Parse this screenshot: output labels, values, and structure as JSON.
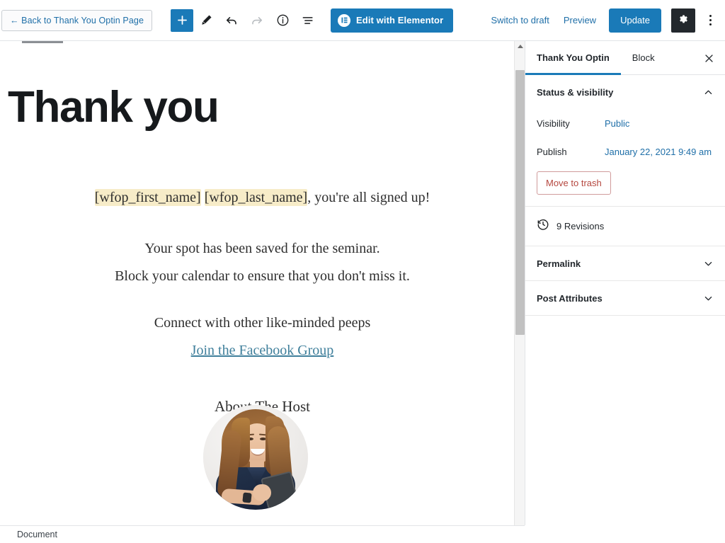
{
  "toolbar": {
    "back_label": "← Back to Thank You Optin Page",
    "add_block_icon": "plus-icon",
    "edit_icon": "pencil-icon",
    "undo_icon": "undo-arrow-icon",
    "redo_icon": "redo-arrow-icon",
    "info_icon": "info-circle-icon",
    "list_view_icon": "list-view-icon",
    "elementor_label": "Edit with Elementor",
    "elementor_icon": "elementor-logo-icon",
    "switch_to_draft_label": "Switch to draft",
    "preview_label": "Preview",
    "update_label": "Update",
    "settings_icon": "gear-icon",
    "more_icon": "kebab-menu-icon"
  },
  "canvas": {
    "title": "Thank you",
    "paragraphs": [
      {
        "id": "greeting",
        "segments": [
          {
            "text": "[wfop_first_name]",
            "highlight": true
          },
          {
            "text": " ",
            "highlight": false
          },
          {
            "text": "[wfop_last_name]",
            "highlight": true
          },
          {
            "text": ", you're all signed up!",
            "highlight": false
          }
        ]
      },
      {
        "id": "spot-saved",
        "text": "Your spot has been saved for the seminar."
      },
      {
        "id": "block-calendar",
        "text": "Block your calendar to ensure that you don't miss it."
      },
      {
        "id": "connect",
        "text": "Connect with other like-minded peeps"
      }
    ],
    "facebook_link_label": "Join the Facebook Group",
    "about_host_heading": "About The Host",
    "host_photo_alt": "host-portrait"
  },
  "sidebar": {
    "tabs": [
      {
        "label": "Thank You Optin",
        "active": true
      },
      {
        "label": "Block",
        "active": false
      }
    ],
    "close_icon": "close-icon",
    "status_panel": {
      "title": "Status & visibility",
      "expanded": true,
      "chevron_icon": "chevron-up-icon",
      "visibility_label": "Visibility",
      "visibility_value": "Public",
      "publish_label": "Publish",
      "publish_value": "January 22, 2021 9:49 am",
      "trash_label": "Move to trash"
    },
    "revisions": {
      "icon": "history-clock-icon",
      "label": "9 Revisions"
    },
    "panels": [
      {
        "title": "Permalink",
        "expanded": false,
        "chevron_icon": "chevron-down-icon"
      },
      {
        "title": "Post Attributes",
        "expanded": false,
        "chevron_icon": "chevron-down-icon"
      }
    ]
  },
  "statusbar": {
    "document_label": "Document"
  },
  "colors": {
    "accent_blue": "#1a7ab8",
    "link_blue": "#1f6fa8",
    "trash_red": "#b5473f",
    "highlight_yellow": "#f7ecc8",
    "dark_button": "#23282d",
    "content_link": "#3f7f9b"
  }
}
